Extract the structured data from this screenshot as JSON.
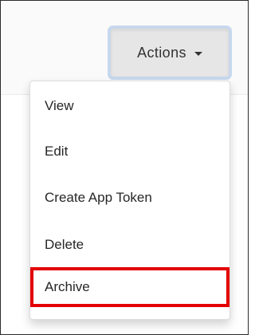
{
  "actions_button": {
    "label": "Actions",
    "icon": "caret-down-icon"
  },
  "menu": {
    "items": [
      {
        "label": "View"
      },
      {
        "label": "Edit"
      },
      {
        "label": "Create App Token"
      },
      {
        "label": "Delete"
      },
      {
        "label": "Archive",
        "highlighted": true
      }
    ]
  },
  "colors": {
    "highlight_border": "#e30000",
    "button_background": "#e6e6e6",
    "text": "#262626"
  }
}
